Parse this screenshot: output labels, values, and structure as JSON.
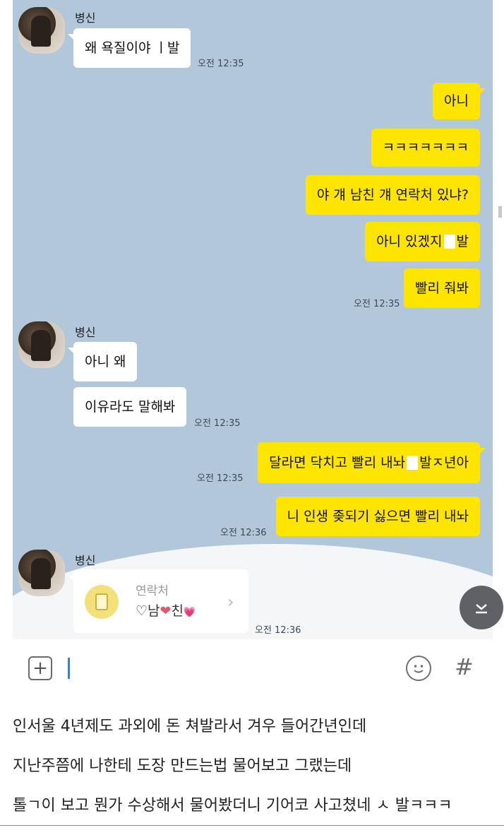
{
  "chat": {
    "sender_name": "병신",
    "messages": [
      {
        "side": "in",
        "text": "왜 욕질이야  ㅣ발",
        "time": "오전 12:35"
      },
      {
        "side": "out",
        "text": "아니"
      },
      {
        "side": "out",
        "text": "ㅋㅋㅋㅋㅋㅋㅋ"
      },
      {
        "side": "out",
        "text": "야 걔 남친 걔 연락처 있냐?"
      },
      {
        "side": "out",
        "text_before": "아니 있겠지",
        "text_after": "발"
      },
      {
        "side": "out",
        "text": "빨리 줘봐",
        "time": "오전 12:35"
      },
      {
        "side": "in",
        "text": "아니 왜"
      },
      {
        "side": "in",
        "text": "이유라도 말해봐",
        "time": "오전 12:35"
      },
      {
        "side": "out",
        "text_before": "달라면 닥치고 빨리 내놔",
        "text_after": "발ㅈ년아",
        "time": "오전 12:35"
      },
      {
        "side": "out",
        "text": "니 인생 좆되기 싫으면 빨리 내놔",
        "time": "오전 12:36"
      }
    ],
    "contact_card": {
      "label": "연락처",
      "name_prefix": "♡남",
      "name_heart": "❤",
      "name_middle": "친",
      "name_suffix": "💗",
      "time": "오전 12:36"
    }
  },
  "input_bar": {
    "plus_icon": "+",
    "emoji_icon": "smiley-icon",
    "hash_icon": "#"
  },
  "caption": {
    "lines": [
      "인서울 4년제도 과외에 돈 쳐발라서 겨우 들어간년인데",
      "지난주쯤에 나한테 도장 만드는법 물어보고 그랬는데",
      "톨ㄱ이 보고 뭔가 수상해서 물어봤더니 기어코 사고쳤네 ㅅ 발ㅋㅋㅋ"
    ]
  },
  "colors": {
    "chat_bg": "#b2c7da",
    "out_bubble": "#fee500",
    "in_bubble": "#ffffff"
  }
}
